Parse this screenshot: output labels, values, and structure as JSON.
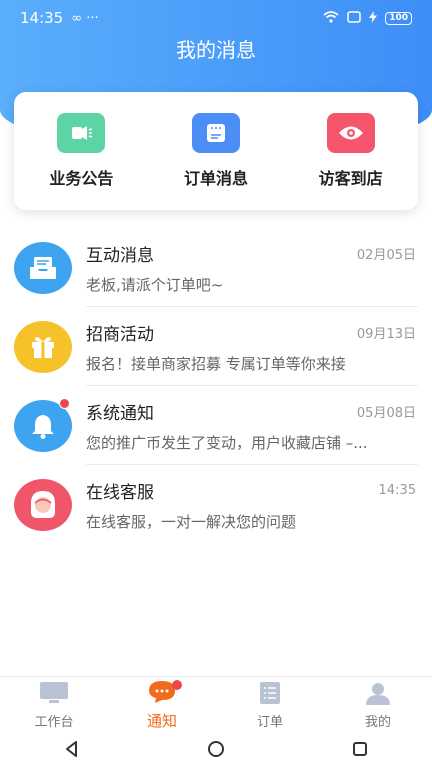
{
  "status_bar": {
    "time": "14:35",
    "extra": "∞ ···",
    "battery": "100"
  },
  "header": {
    "title": "我的消息"
  },
  "quick_actions": [
    {
      "label": "业务公告",
      "icon": "megaphone-icon",
      "color": "#5dd3a6"
    },
    {
      "label": "订单消息",
      "icon": "order-list-icon",
      "color": "#4d8ef6"
    },
    {
      "label": "访客到店",
      "icon": "eye-icon",
      "color": "#f5566c"
    }
  ],
  "messages": [
    {
      "title": "互动消息",
      "time": "02月05日",
      "preview": "老板,请派个订单吧~",
      "icon": "inbox-icon",
      "color": "#3ea4f0",
      "unread": false
    },
    {
      "title": "招商活动",
      "time": "09月13日",
      "preview": "报名！接单商家招募 专属订单等你来接",
      "icon": "gift-icon",
      "color": "#f5c22a",
      "unread": false
    },
    {
      "title": "系统通知",
      "time": "05月08日",
      "preview": "您的推广币发生了变动，用户收藏店铺 –...",
      "icon": "bell-icon",
      "color": "#3ea4f0",
      "unread": true
    },
    {
      "title": "在线客服",
      "time": "14:35",
      "preview": "在线客服，一对一解决您的问题",
      "icon": "service-agent-icon",
      "color": "#f0566a",
      "unread": false
    }
  ],
  "tab_bar": [
    {
      "label": "工作台",
      "icon": "monitor-icon",
      "active": false
    },
    {
      "label": "通知",
      "icon": "chat-bubble-icon",
      "active": true,
      "badge": true
    },
    {
      "label": "订单",
      "icon": "document-icon",
      "active": false
    },
    {
      "label": "我的",
      "icon": "user-icon",
      "active": false
    }
  ],
  "colors": {
    "header_gradient_start": "#5aaefc",
    "header_gradient_end": "#3e8ef7",
    "active_tab": "#f26a1b"
  }
}
